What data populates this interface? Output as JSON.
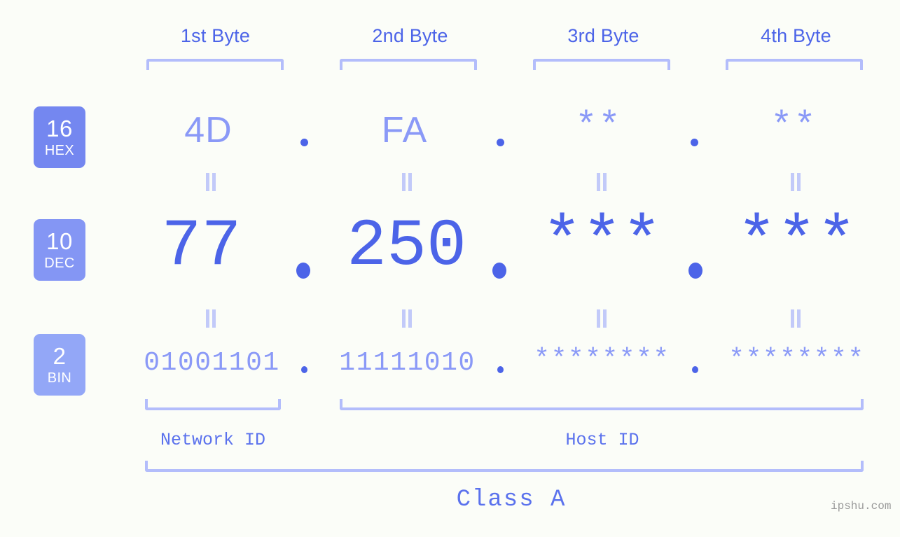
{
  "background": "#fbfdf8",
  "colors": {
    "accent_dark": "#4c64e8",
    "accent_mid": "#5b72ed",
    "accent_light": "#8a99f7",
    "bracket": "#b3bdfb",
    "eq_mark": "#c2caf9",
    "badge_hex": "#7487f0",
    "badge_dec": "#8496f4",
    "badge_bin": "#93a7f7",
    "watermark": "#9a9a9a"
  },
  "byte_headers": [
    {
      "label": "1st Byte"
    },
    {
      "label": "2nd Byte"
    },
    {
      "label": "3rd Byte"
    },
    {
      "label": "4th Byte"
    }
  ],
  "rows": [
    {
      "key": "hex",
      "badge": {
        "num": "16",
        "name": "HEX"
      },
      "values": [
        "4D",
        "FA",
        "**",
        "**"
      ],
      "separator": "."
    },
    {
      "key": "dec",
      "badge": {
        "num": "10",
        "name": "DEC"
      },
      "values": [
        "77",
        "250",
        "***",
        "***"
      ],
      "separator": "."
    },
    {
      "key": "bin",
      "badge": {
        "num": "2",
        "name": "BIN"
      },
      "values": [
        "01001101",
        "11111010",
        "********",
        "********"
      ],
      "separator": "."
    }
  ],
  "equality_marks": {
    "glyph": "||",
    "count_per_row": 4,
    "rows": 2
  },
  "id_sections": [
    {
      "label": "Network ID"
    },
    {
      "label": "Host ID"
    }
  ],
  "class_label": "Class A",
  "watermark": "ipshu.com"
}
